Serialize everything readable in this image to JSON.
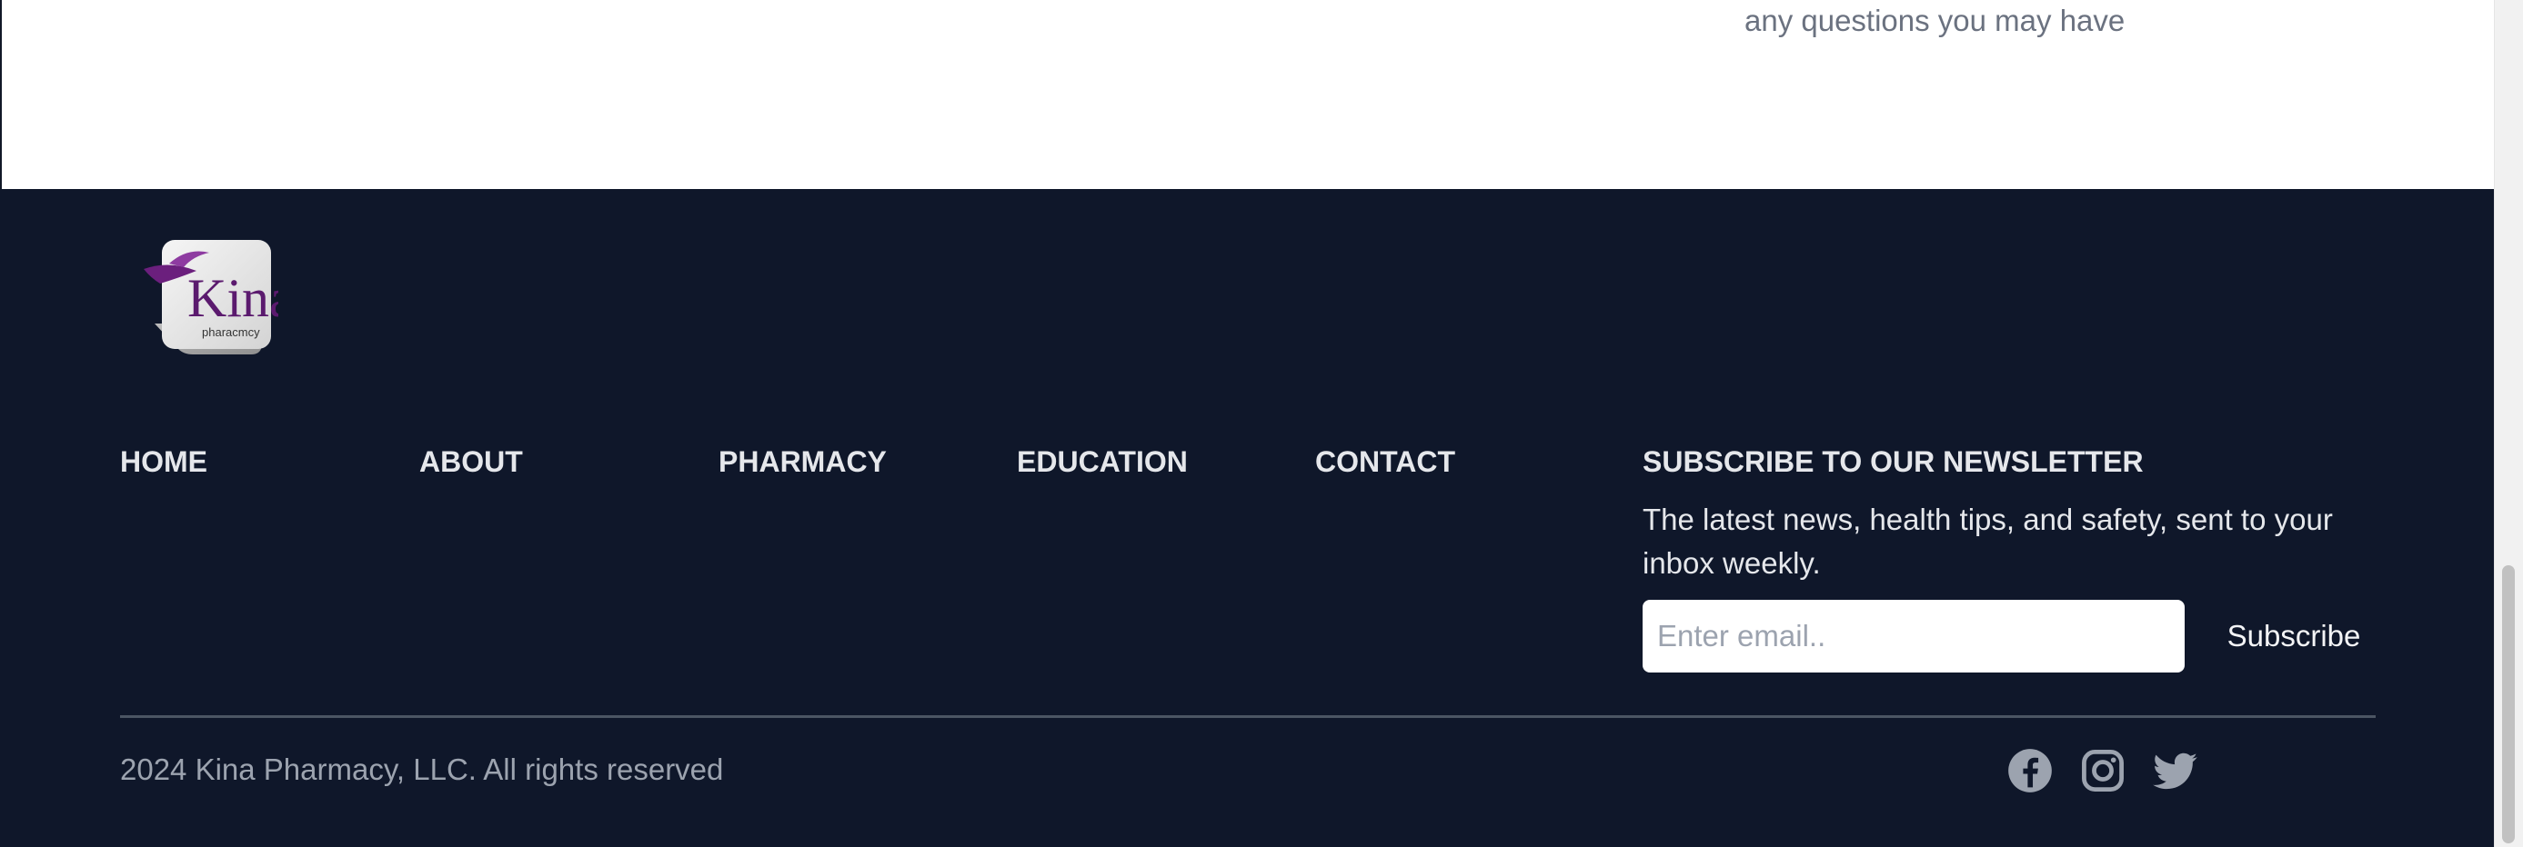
{
  "top": {
    "text": "any questions you may have"
  },
  "logo": {
    "brand": "Kina",
    "tagline": "pharacmcy"
  },
  "nav": {
    "items": [
      {
        "label": "HOME"
      },
      {
        "label": "ABOUT"
      },
      {
        "label": "PHARMACY"
      },
      {
        "label": "EDUCATION"
      },
      {
        "label": "CONTACT"
      }
    ]
  },
  "newsletter": {
    "title": "SUBSCRIBE TO OUR NEWSLETTER",
    "description": "The latest news, health tips, and safety, sent to your inbox weekly.",
    "email_placeholder": "Enter email..",
    "email_value": "",
    "button_label": "Subscribe"
  },
  "footer": {
    "copyright": "2024 Kina Pharmacy, LLC. All rights reserved",
    "social": [
      {
        "icon": "facebook-icon"
      },
      {
        "icon": "instagram-icon"
      },
      {
        "icon": "twitter-icon"
      }
    ]
  },
  "colors": {
    "footer_bg": "#0f172a",
    "link_text": "#e5e7eb",
    "muted_text": "#9ca3af",
    "divider": "#4b5563",
    "brand_purple": "#5b1a6e"
  }
}
